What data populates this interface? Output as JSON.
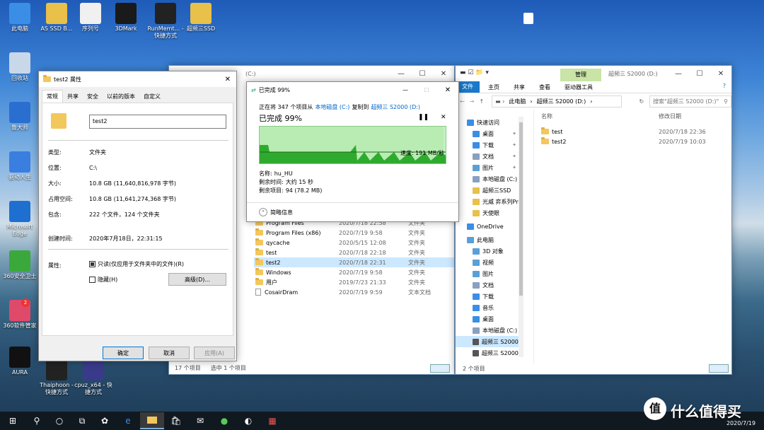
{
  "desktop": {
    "icons": [
      {
        "label": "此电脑",
        "color": "#3a8ee6"
      },
      {
        "label": "AS SSD B...",
        "color": "#e8c04a"
      },
      {
        "label": "序列号",
        "color": "#f0f0f0"
      },
      {
        "label": "3DMark",
        "color": "#1a1a1a"
      },
      {
        "label": "RunMemt... - 快捷方式",
        "color": "#222"
      },
      {
        "label": "超频三SSD",
        "color": "#e8c04a"
      },
      {
        "label": "回收站",
        "color": "#c8d8e8"
      },
      {
        "label": "鲁大师",
        "color": "#2a6fd0"
      },
      {
        "label": "驱动人生",
        "color": "#3a7ee0"
      },
      {
        "label": "Microsoft Edge",
        "color": "#1f6fd0"
      },
      {
        "label": "360安全卫士",
        "color": "#3aa83a"
      },
      {
        "label": "360软件管家",
        "color": "#e04a6a"
      },
      {
        "label": "AURA",
        "color": "#111"
      },
      {
        "label": "Thaiphoon - 快捷方式",
        "color": "#222"
      },
      {
        "label": "cpuz_x64 - 快捷方式",
        "color": "#3a3a8a"
      }
    ],
    "badge_360": "2"
  },
  "properties": {
    "title": "test2 属性",
    "tabs": [
      "常规",
      "共享",
      "安全",
      "以前的版本",
      "自定义"
    ],
    "name_value": "test2",
    "fields": [
      {
        "label": "类型:",
        "value": "文件夹"
      },
      {
        "label": "位置:",
        "value": "C:\\"
      },
      {
        "label": "大小:",
        "value": "10.8 GB (11,640,816,978 字节)"
      },
      {
        "label": "占用空间:",
        "value": "10.8 GB (11,641,274,368 字节)"
      },
      {
        "label": "包含:",
        "value": "222 个文件，124 个文件夹"
      },
      {
        "label": "创建时间:",
        "value": "2020年7月18日，22:31:15"
      }
    ],
    "attributes_label": "属性:",
    "readonly_label": "只读(仅应用于文件夹中的文件)(R)",
    "hidden_label": "隐藏(H)",
    "advanced_button": "高级(D)...",
    "ok_button": "确定",
    "cancel_button": "取消",
    "apply_button": "应用(A)"
  },
  "copy_dialog": {
    "title": "已完成 99%",
    "line1_prefix": "正在将 347 个项目从",
    "source": "本地磁盘 (C:)",
    "line1_mid": "复制到",
    "dest": "超频三 S2000 (D:)",
    "percent_title": "已完成 99%",
    "speed": "速度: 191 MB/秒",
    "progress_fraction": 0.99,
    "name_label": "名称:",
    "name_value": "hu_HU",
    "time_label": "剩余时间:",
    "time_value": "大约 15 秒",
    "items_label": "剩余项目:",
    "items_value": "94 (78.2 MB)",
    "details_toggle": "简略信息"
  },
  "explorer_c": {
    "title_drive": "(C:)",
    "rows": [
      {
        "name": "Program Files",
        "date": "2020/7/18 22:58",
        "type": "文件夹",
        "kind": "folder"
      },
      {
        "name": "Program Files (x86)",
        "date": "2020/7/19 9:58",
        "type": "文件夹",
        "kind": "folder"
      },
      {
        "name": "qycache",
        "date": "2020/5/15 12:08",
        "type": "文件夹",
        "kind": "folder"
      },
      {
        "name": "test",
        "date": "2020/7/18 22:18",
        "type": "文件夹",
        "kind": "folder"
      },
      {
        "name": "test2",
        "date": "2020/7/18 22:31",
        "type": "文件夹",
        "kind": "folder",
        "selected": true
      },
      {
        "name": "Windows",
        "date": "2020/7/19 9:58",
        "type": "文件夹",
        "kind": "folder"
      },
      {
        "name": "用户",
        "date": "2019/7/23 21:33",
        "type": "文件夹",
        "kind": "folder"
      },
      {
        "name": "CosairDram",
        "date": "2020/7/19 9:59",
        "type": "文本文档",
        "kind": "file"
      }
    ],
    "status_count": "17 个项目",
    "status_selected": "选中 1 个项目"
  },
  "explorer_d": {
    "ribbon_tabs": [
      "文件",
      "主页",
      "共享",
      "查看"
    ],
    "manage_tab": "管理",
    "drive_tools_tab": "驱动器工具",
    "title": "超频三 S2000 (D:)",
    "breadcrumb": [
      "此电脑",
      "超频三 S2000 (D:)"
    ],
    "search_placeholder": "搜索\"超频三 S2000 (D:)\"",
    "col_name": "名称",
    "col_date": "修改日期",
    "rows": [
      {
        "name": "test",
        "date": "2020/7/18 22:36"
      },
      {
        "name": "test2",
        "date": "2020/7/19 10:03"
      }
    ],
    "nav": [
      {
        "label": "快速访问",
        "color": "#3a8ee6",
        "indent": 0
      },
      {
        "label": "桌面",
        "color": "#3a8ee6",
        "indent": 1,
        "pin": true
      },
      {
        "label": "下载",
        "color": "#3a8ee6",
        "indent": 1,
        "pin": true
      },
      {
        "label": "文档",
        "color": "#8aa0c0",
        "indent": 1,
        "pin": true
      },
      {
        "label": "图片",
        "color": "#5aa0d8",
        "indent": 1,
        "pin": true
      },
      {
        "label": "本地磁盘 (C:)",
        "color": "#8aa0c0",
        "indent": 1
      },
      {
        "label": "超频三SSD",
        "color": "#e8c04a",
        "indent": 1
      },
      {
        "label": "光威 弈系列Pro",
        "color": "#e8c04a",
        "indent": 1
      },
      {
        "label": "天使眼",
        "color": "#e8c04a",
        "indent": 1
      },
      {
        "label": "OneDrive",
        "color": "#3a8ee6",
        "indent": 0
      },
      {
        "label": "此电脑",
        "color": "#5aa0d8",
        "indent": 0
      },
      {
        "label": "3D 对象",
        "color": "#5aa0d8",
        "indent": 1
      },
      {
        "label": "视频",
        "color": "#5aa0d8",
        "indent": 1
      },
      {
        "label": "图片",
        "color": "#5aa0d8",
        "indent": 1
      },
      {
        "label": "文档",
        "color": "#8aa0c0",
        "indent": 1
      },
      {
        "label": "下载",
        "color": "#3a8ee6",
        "indent": 1
      },
      {
        "label": "音乐",
        "color": "#3a8ee6",
        "indent": 1
      },
      {
        "label": "桌面",
        "color": "#3a8ee6",
        "indent": 1
      },
      {
        "label": "本地磁盘 (C:)",
        "color": "#8aa0c0",
        "indent": 1
      },
      {
        "label": "超频三 S2000 (D:",
        "color": "#555",
        "indent": 1,
        "selected": true
      },
      {
        "label": "超频三 S2000 (D:",
        "color": "#555",
        "indent": 1
      }
    ],
    "status": "2 个项目"
  },
  "taskbar": {
    "date": "2020/7/19",
    "watermark": "什么值得买"
  }
}
